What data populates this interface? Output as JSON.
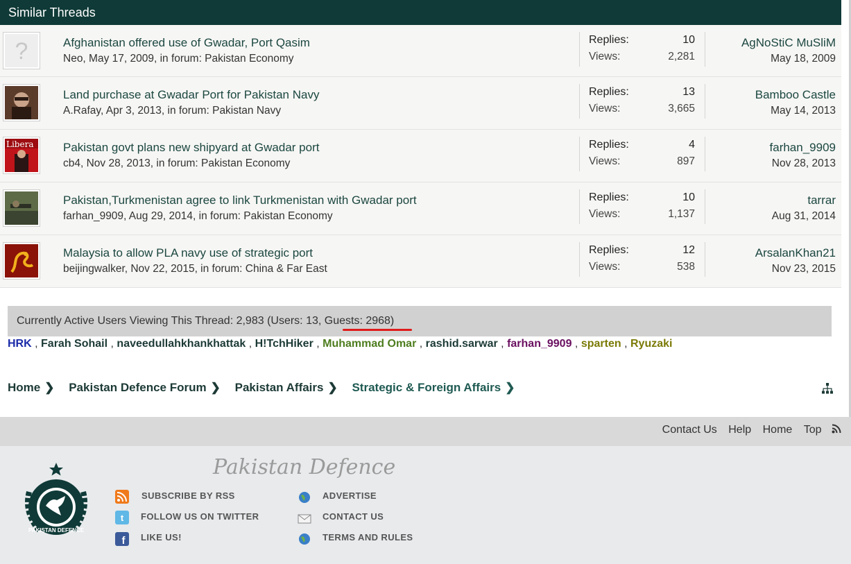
{
  "similar": {
    "title": "Similar Threads",
    "threads": [
      {
        "title": "Afghanistan offered use of Gwadar, Port Qasim",
        "meta": "Neo, May 17, 2009, in forum: Pakistan Economy",
        "replies_label": "Replies:",
        "replies": "10",
        "views_label": "Views:",
        "views": "2,281",
        "last_user": "AgNoStiC MuSliM",
        "last_date": "May 18, 2009"
      },
      {
        "title": "Land purchase at Gwadar Port for Pakistan Navy",
        "meta": "A.Rafay, Apr 3, 2013, in forum: Pakistan Navy",
        "replies_label": "Replies:",
        "replies": "13",
        "views_label": "Views:",
        "views": "3,665",
        "last_user": "Bamboo Castle",
        "last_date": "May 14, 2013"
      },
      {
        "title": "Pakistan govt plans new shipyard at Gwadar port",
        "meta": "cb4, Nov 28, 2013, in forum: Pakistan Economy",
        "replies_label": "Replies:",
        "replies": "4",
        "views_label": "Views:",
        "views": "897",
        "last_user": "farhan_9909",
        "last_date": "Nov 28, 2013"
      },
      {
        "title": "Pakistan,Turkmenistan agree to link Turkmenistan with Gwadar port",
        "meta": "farhan_9909, Aug 29, 2014, in forum: Pakistan Economy",
        "replies_label": "Replies:",
        "replies": "10",
        "views_label": "Views:",
        "views": "1,137",
        "last_user": "tarrar",
        "last_date": "Aug 31, 2014"
      },
      {
        "title": "Malaysia to allow PLA navy use of strategic port",
        "meta": "beijingwalker, Nov 22, 2015, in forum: China & Far East",
        "replies_label": "Replies:",
        "replies": "12",
        "views_label": "Views:",
        "views": "538",
        "last_user": "ArsalanKhan21",
        "last_date": "Nov 23, 2015"
      }
    ]
  },
  "active": {
    "text": "Currently Active Users Viewing This Thread: 2,983 (Users: 13, Guests: 2968)",
    "users": [
      "HRK",
      "Farah Sohail",
      "naveedullahkhankhattak",
      "H!TchHiker",
      "Muhammad Omar",
      "rashid.sarwar",
      "farhan_9909",
      "sparten",
      "Ryuzaki"
    ],
    "separator": ","
  },
  "breadcrumb": [
    "Home",
    "Pakistan Defence Forum",
    "Pakistan Affairs",
    "Strategic & Foreign Affairs"
  ],
  "footer": {
    "links": [
      "Contact Us",
      "Help",
      "Home",
      "Top"
    ],
    "brand": "Pakistan Defence",
    "logo_text": "PAKISTAN DEFENCE",
    "left_links": [
      "SUBSCRIBE BY RSS",
      "FOLLOW US ON TWITTER",
      "LIKE US!"
    ],
    "right_links": [
      "ADVERTISE",
      "CONTACT US",
      "TERMS AND RULES"
    ]
  },
  "colors": {
    "header": "#0f3a37",
    "accent_underline": "#e01a1a",
    "link": "#1c4740"
  },
  "icons": [
    "sitemap-icon",
    "rss-icon",
    "twitter-icon",
    "facebook-icon",
    "globe-icon",
    "mail-icon",
    "chevron-right-icon"
  ]
}
